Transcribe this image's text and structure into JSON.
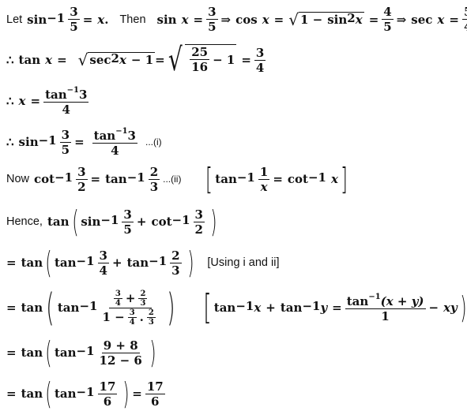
{
  "lines": [
    {
      "id": "line-1",
      "text": {
        "let": "Let",
        "then": "Then",
        "sin": "sin",
        "cos": "cos",
        "sec": "sec",
        "inv": "−1",
        "sq": "2",
        "x": "x",
        "eq": "=",
        "dot": ".",
        "implies": "⇒",
        "one_minus": "1 −",
        "frac_3": "3",
        "frac_5": "5",
        "frac_4": "4"
      }
    }
  ],
  "l2": {
    "therefore": "∴",
    "tan": "tan",
    "x": "x",
    "eq": "=",
    "sec": "sec",
    "sq": "2",
    "minus1": "− 1",
    "n25": "25",
    "n16": "16",
    "n3": "3",
    "n4": "4"
  },
  "l3": {
    "therefore": "∴",
    "x": "x",
    "eq": "=",
    "tan": "tan",
    "inv": "−1",
    "n3": "3",
    "n4": "4"
  },
  "l4": {
    "therefore": "∴",
    "sin": "sin",
    "inv": "−1",
    "n3": "3",
    "n5": "5",
    "eq": "=",
    "tan": "tan",
    "n4": "4",
    "tag": "...(i)"
  },
  "l5": {
    "now": "Now",
    "cot": "cot",
    "tan": "tan",
    "inv": "−1",
    "n3": "3",
    "n2": "2",
    "eq": "=",
    "tag": "...(ii)",
    "n1": "1",
    "x": "x"
  },
  "l6": {
    "hence": "Hence,",
    "tan": "tan",
    "sin": "sin",
    "cot": "cot",
    "inv": "−1",
    "n3": "3",
    "n5": "5",
    "n2": "2",
    "plus": "+"
  },
  "l7": {
    "eq": "=",
    "tan": "tan",
    "inv": "−1",
    "n3": "3",
    "n4": "4",
    "n2": "2",
    "plus": "+",
    "note": "[Using i and ii]"
  },
  "l8": {
    "eq": "=",
    "tan": "tan",
    "inv": "−1",
    "n3": "3",
    "n4": "4",
    "n2": "2",
    "plus": "+",
    "one_minus": "1 −",
    "dot": ".",
    "x": "x",
    "y": "y",
    "xy": "xy",
    "x_plus_y": "(x + y)",
    "n1": "1",
    "minus": "−"
  },
  "l9": {
    "eq": "=",
    "tan": "tan",
    "inv": "−1",
    "num": "9 + 8",
    "den": "12 − 6"
  },
  "l10": {
    "eq": "=",
    "tan": "tan",
    "inv": "−1",
    "n17": "17",
    "n6": "6"
  }
}
